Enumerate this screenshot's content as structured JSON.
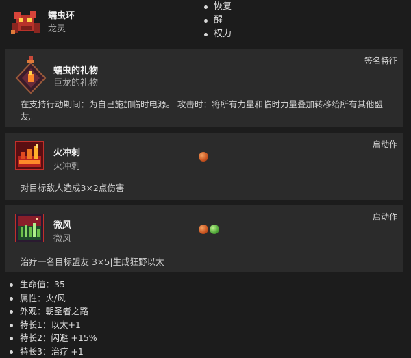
{
  "header": {
    "name": "蠕虫环",
    "subtitle": "龙灵",
    "traits": [
      "恢复",
      "醒",
      "权力"
    ]
  },
  "cards": [
    {
      "title": "蠕虫的礼物",
      "subtitle": "巨龙的礼物",
      "tag": "签名特征",
      "description": "在支持行动期间：为自己施加临时电源。 攻击时：将所有力量和临时力量叠加转移给所有其他盟友。",
      "orbs": [],
      "icon": "dragon-sigil-icon"
    },
    {
      "title": "火冲刺",
      "subtitle": "火冲刺",
      "tag": "启动作",
      "description": "对目标敌人造成3×2点伤害",
      "orbs": [
        "#e0682a"
      ],
      "icon": "fire-dash-icon"
    },
    {
      "title": "微风",
      "subtitle": "微风",
      "tag": "启动作",
      "description": "治疗一名目标盟友 3×5|生成狂野以太",
      "orbs": [
        "#e0682a",
        "#6cc04a"
      ],
      "icon": "breeze-icon"
    }
  ],
  "stats": [
    "生命值：35",
    "属性：火/风",
    "外观：朝圣者之路",
    "特长1：以太+1",
    "特长2：闪避 +15%",
    "特长3：治疗 +1"
  ],
  "colors": {
    "fire_orb": "#e0682a",
    "wind_orb": "#6cc04a",
    "card_bg": "#2b2b2b",
    "page_bg": "#1c1c1c"
  }
}
